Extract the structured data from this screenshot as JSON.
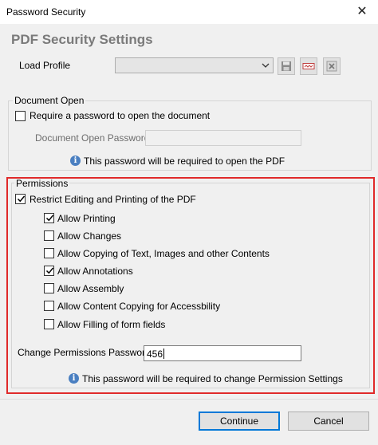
{
  "window": {
    "title": "Password Security"
  },
  "heading": "PDF Security Settings",
  "load_profile": {
    "label": "Load Profile",
    "selected": ""
  },
  "document_open": {
    "legend": "Document Open",
    "require_label": "Require a password to open the document",
    "require_checked": false,
    "password_label": "Document Open Password:",
    "password_value": "",
    "info": "This password will be required to open the PDF"
  },
  "permissions": {
    "legend": "Permissions",
    "restrict_label": "Restrict Editing and Printing of the PDF",
    "restrict_checked": true,
    "options": [
      {
        "label": "Allow Printing",
        "checked": true
      },
      {
        "label": "Allow Changes",
        "checked": false
      },
      {
        "label": "Allow Copying of Text, Images and other Contents",
        "checked": false
      },
      {
        "label": "Allow Annotations",
        "checked": true
      },
      {
        "label": "Allow Assembly",
        "checked": false
      },
      {
        "label": "Allow Content Copying for Accessbility",
        "checked": false
      },
      {
        "label": "Allow Filling of form fields",
        "checked": false
      }
    ],
    "password_label": "Change Permissions Password:",
    "password_value": "456",
    "info": "This password will be required to change Permission Settings"
  },
  "buttons": {
    "continue": "Continue",
    "cancel": "Cancel"
  },
  "colors": {
    "highlight": "#e02a2a",
    "info_icon": "#4a7fc1",
    "primary_border": "#0078d7"
  },
  "icons": {
    "close": "close-icon",
    "save": "save-icon",
    "edit": "edit-icon",
    "delete": "delete-icon",
    "info": "info-icon",
    "dropdown": "chevron-down-icon"
  }
}
